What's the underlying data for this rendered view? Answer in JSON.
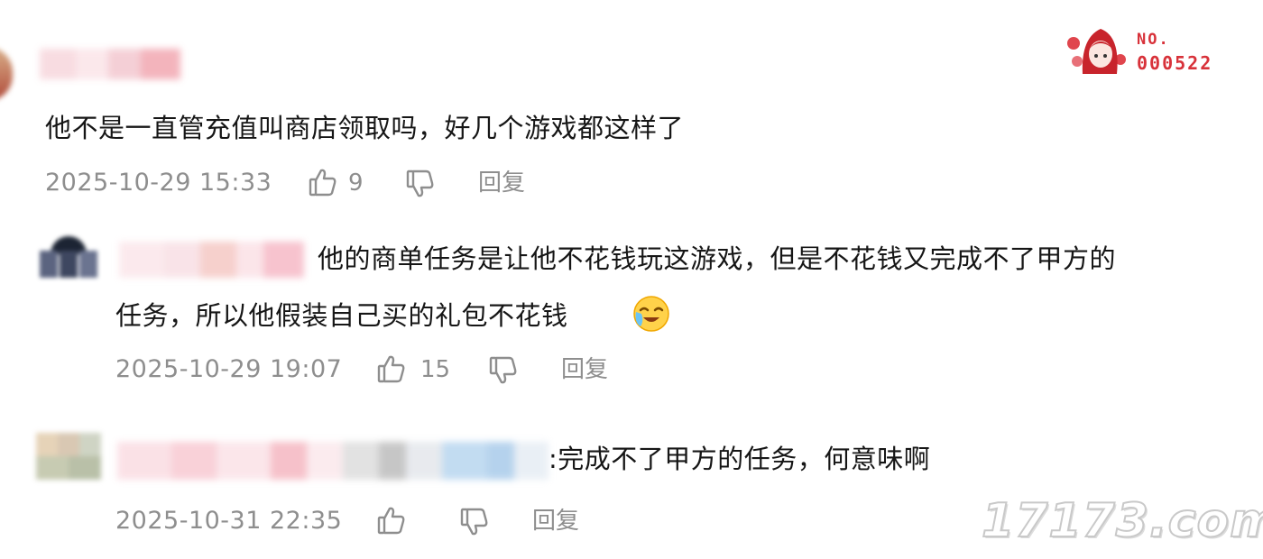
{
  "badge": {
    "line1": "NO.",
    "line2": "000522"
  },
  "comments": [
    {
      "text": "他不是一直管充值叫商店领取吗，好几个游戏都这样了",
      "timestamp": "2025-10-29 15:33",
      "likes": "9",
      "reply_label": "回复"
    },
    {
      "text_line1": "他的商单任务是让他不花钱玩这游戏，但是不花钱又完成不了甲方的",
      "text_line2": "任务，所以他假装自己买的礼包不花钱",
      "timestamp": "2025-10-29 19:07",
      "likes": "15",
      "reply_label": "回复"
    },
    {
      "text": ":完成不了甲方的任务，何意味啊",
      "timestamp": "2025-10-31 22:35",
      "likes": "",
      "reply_label": "回复"
    }
  ],
  "watermark": "17173.com",
  "colors": {
    "text": "#161616",
    "meta": "#8e8e8e",
    "badge": "#d8323a"
  }
}
